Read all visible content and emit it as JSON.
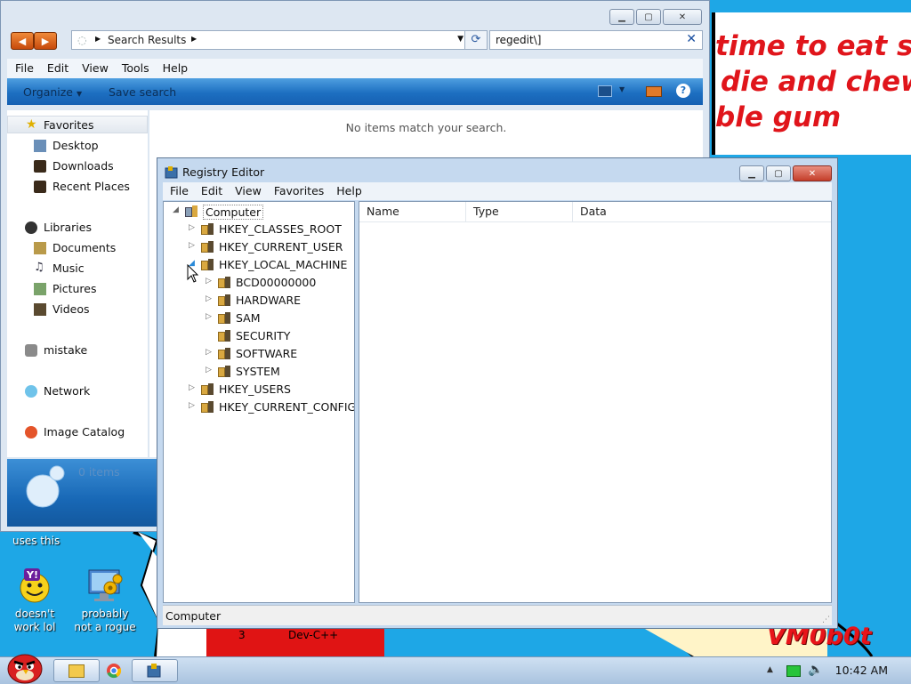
{
  "wallpaper": {
    "top_lines": [
      "time to eat shit",
      "die and chew",
      "ble gum"
    ],
    "uses_this": "uses this",
    "tag": "VM0b0t",
    "task_number": "3",
    "task_label": "Dev-C++"
  },
  "desktop_icons": [
    {
      "label": "doesn't work lol",
      "icon": "yahoo-messenger-icon"
    },
    {
      "label": "probably not a rogue",
      "icon": "monitor-gears-icon"
    }
  ],
  "explorer": {
    "address": "Search Results",
    "search_value": "regedit\\]",
    "menu": [
      "File",
      "Edit",
      "View",
      "Tools",
      "Help"
    ],
    "commands": {
      "organize": "Organize",
      "save_search": "Save search"
    },
    "empty_message": "No items match your search.",
    "status_items": "0 items",
    "nav": {
      "favorites": "Favorites",
      "favorites_items": [
        "Desktop",
        "Downloads",
        "Recent Places"
      ],
      "libraries": "Libraries",
      "libraries_items": [
        "Documents",
        "Music",
        "Pictures",
        "Videos"
      ],
      "homegroup": "mistake",
      "network": "Network",
      "image_catalog": "Image Catalog"
    }
  },
  "regedit": {
    "title": "Registry Editor",
    "menu": [
      "File",
      "Edit",
      "View",
      "Favorites",
      "Help"
    ],
    "tree_root": "Computer",
    "hives": [
      "HKEY_CLASSES_ROOT",
      "HKEY_CURRENT_USER",
      "HKEY_LOCAL_MACHINE"
    ],
    "hklm_children": [
      "BCD00000000",
      "HARDWARE",
      "SAM",
      "SECURITY",
      "SOFTWARE",
      "SYSTEM"
    ],
    "hives_after": [
      "HKEY_USERS",
      "HKEY_CURRENT_CONFIG"
    ],
    "columns": [
      "Name",
      "Type",
      "Data"
    ],
    "status": "Computer"
  },
  "taskbar": {
    "clock": "10:42 AM"
  }
}
